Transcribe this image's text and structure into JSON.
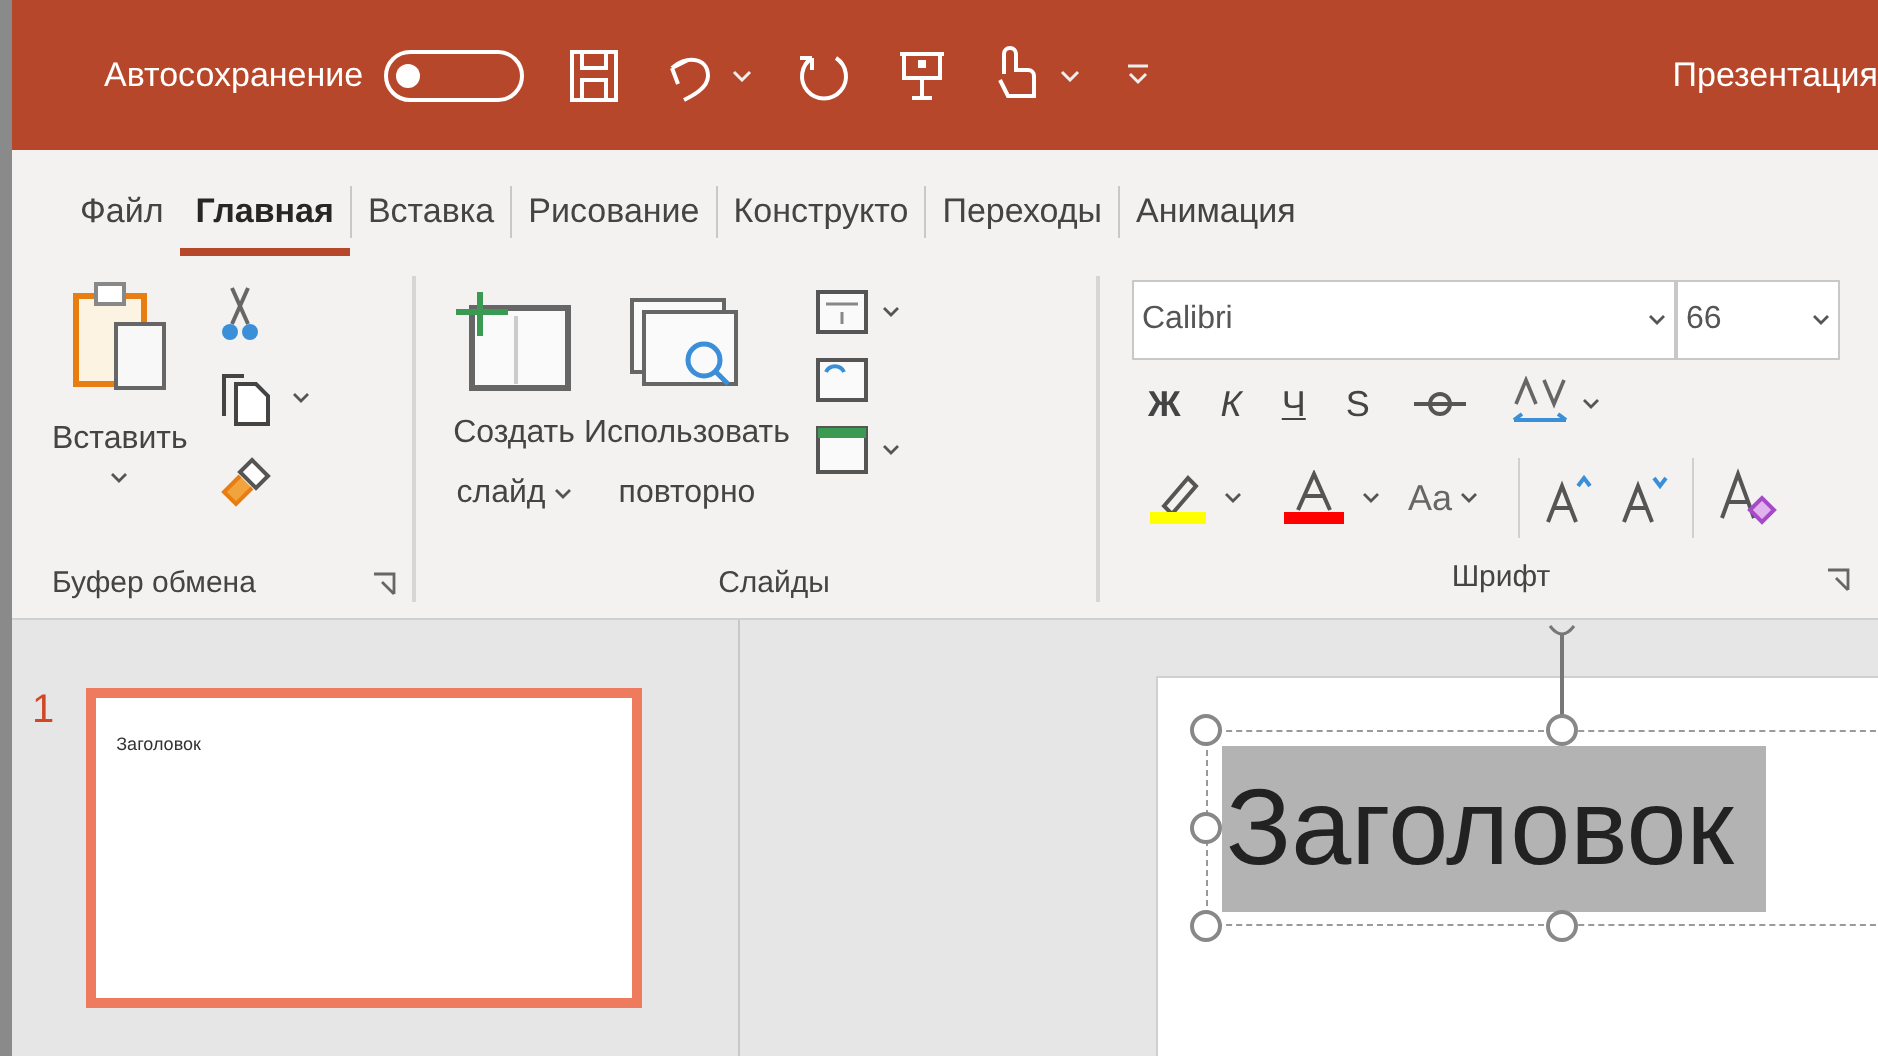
{
  "title_bar": {
    "autosave_label": "Автосохранение",
    "autosave_on": false,
    "document_title": "Презентация"
  },
  "tabs": [
    {
      "label": "Файл",
      "selected": false
    },
    {
      "label": "Главная",
      "selected": true
    },
    {
      "label": "Вставка",
      "selected": false
    },
    {
      "label": "Рисование",
      "selected": false
    },
    {
      "label": "Конструкто",
      "selected": false
    },
    {
      "label": "Переходы",
      "selected": false
    },
    {
      "label": "Анимация",
      "selected": false
    }
  ],
  "ribbon": {
    "clipboard": {
      "paste_label": "Вставить",
      "group_label": "Буфер обмена"
    },
    "slides": {
      "new_slide_line1": "Создать",
      "new_slide_line2": "слайд",
      "reuse_line1": "Использовать",
      "reuse_line2": "повторно",
      "group_label": "Слайды"
    },
    "font": {
      "font_name": "Calibri",
      "font_size": "66",
      "bold": "Ж",
      "italic": "К",
      "underline": "Ч",
      "shadow": "S",
      "change_case": "Aa",
      "group_label": "Шрифт"
    }
  },
  "thumbnails": [
    {
      "number": "1",
      "title": "Заголовок",
      "selected": true
    }
  ],
  "slide": {
    "title": "Заголовок",
    "title_selected": true
  }
}
